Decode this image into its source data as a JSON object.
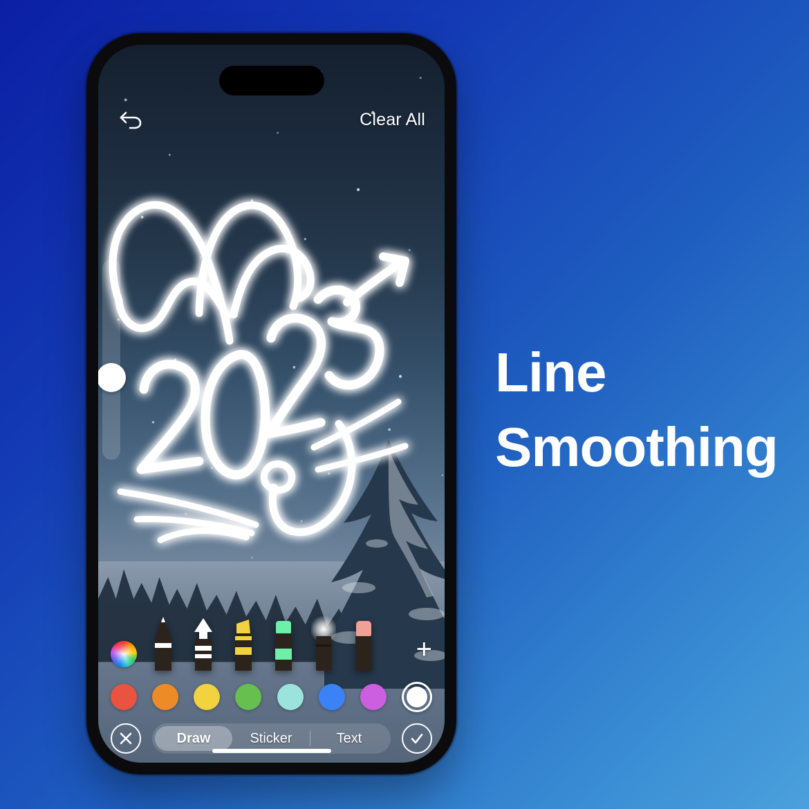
{
  "promo": {
    "line1": "Line",
    "line2": "Smoothing"
  },
  "background": {
    "gradient_start": "#0b1fa4",
    "gradient_end": "#4ba0dc"
  },
  "phone": {
    "frame_color": "#0b0b0e",
    "dynamic_island": "dynamic-island"
  },
  "editor": {
    "topbar": {
      "undo_icon": "undo-arrow-icon",
      "clear_all_label": "Clear All"
    },
    "canvas": {
      "wallpaper_description": "snowy night forest with starry sky",
      "drawing_description": "glowing white handwritten 2023 with rabbit ears, whiskers and nose"
    },
    "size_slider": {
      "name": "brush-size-slider",
      "value_percent": 50
    },
    "tools": [
      {
        "name": "pen",
        "tip_color": "#ffffff",
        "band_color": "#ffffff",
        "selected": false
      },
      {
        "name": "marker-arrow",
        "tip_color": "#ffffff",
        "band_color": "#ffffff",
        "selected": false
      },
      {
        "name": "highlighter-yellow",
        "tip_color": "#f2d23f",
        "band_color": "#f2d23f",
        "selected": false
      },
      {
        "name": "highlighter-green",
        "tip_color": "#6ff0a8",
        "band_color": "#6ff0a8",
        "selected": false
      },
      {
        "name": "neon-glow-brush",
        "tip_color": "#ffffff",
        "band_color": "#2a221c",
        "selected": true
      },
      {
        "name": "eraser",
        "tip_color": "#efa196",
        "band_color": "#2a221c",
        "selected": false
      }
    ],
    "add_tool_label": "+",
    "colorwheel_label": "color-wheel",
    "swatches": [
      {
        "name": "red",
        "hex": "#ea5242"
      },
      {
        "name": "orange",
        "hex": "#ed8c26"
      },
      {
        "name": "yellow",
        "hex": "#f2d23f"
      },
      {
        "name": "green",
        "hex": "#67bf4f"
      },
      {
        "name": "turquoise",
        "hex": "#9ce3de"
      },
      {
        "name": "blue",
        "hex": "#3b82f6"
      },
      {
        "name": "magenta",
        "hex": "#cc5fe0"
      }
    ],
    "selected_color": {
      "name": "white",
      "hex": "#ffffff"
    },
    "tabs": [
      {
        "label": "Draw",
        "active": true
      },
      {
        "label": "Sticker",
        "active": false
      },
      {
        "label": "Text",
        "active": false
      }
    ],
    "cancel_icon": "close-x-icon",
    "confirm_icon": "checkmark-icon"
  }
}
